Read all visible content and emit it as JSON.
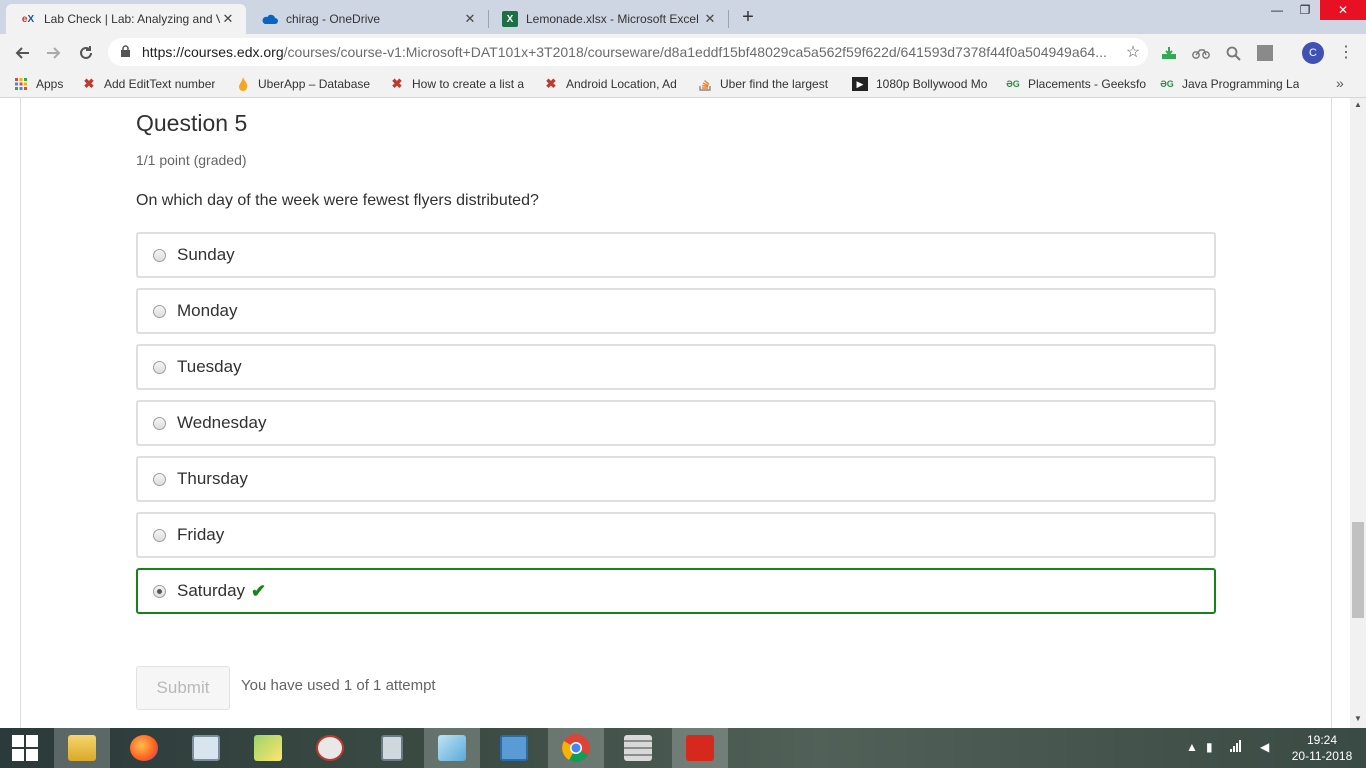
{
  "browser": {
    "tabs": [
      {
        "favicon": "edx-icon",
        "title": "Lab Check | Lab: Analyzing and V",
        "active": true
      },
      {
        "favicon": "onedrive-icon",
        "title": "chirag - OneDrive",
        "active": false
      },
      {
        "favicon": "excel-icon",
        "title": "Lemonade.xlsx - Microsoft Excel O",
        "active": false
      }
    ],
    "url_host": "https://courses.edx.org",
    "url_path": "/courses/course-v1:Microsoft+DAT101x+3T2018/courseware/d8a1eddf15bf48029ca5a562f59f622d/641593d7378f44f0a504949a64...",
    "profile_initial": "C",
    "bookmarks": [
      {
        "icon": "apps-grid-icon",
        "label": "Apps"
      },
      {
        "icon": "x-icon",
        "label": "Add EditText number"
      },
      {
        "icon": "flame-icon",
        "label": "UberApp – Database"
      },
      {
        "icon": "x-icon",
        "label": "How to create a list a"
      },
      {
        "icon": "x-icon",
        "label": "Android Location, Ad"
      },
      {
        "icon": "stackoverflow-icon",
        "label": "Uber find the largest"
      },
      {
        "icon": "play-icon",
        "label": "1080p Bollywood Mo"
      },
      {
        "icon": "gfg-icon",
        "label": "Placements - Geeksfo"
      },
      {
        "icon": "gfg-icon",
        "label": "Java Programming La"
      }
    ]
  },
  "question": {
    "title": "Question 5",
    "points": "1/1 point (graded)",
    "text": "On which day of the week were fewest flyers distributed?",
    "options": [
      {
        "label": "Sunday",
        "selected": false
      },
      {
        "label": "Monday",
        "selected": false
      },
      {
        "label": "Tuesday",
        "selected": false
      },
      {
        "label": "Wednesday",
        "selected": false
      },
      {
        "label": "Thursday",
        "selected": false
      },
      {
        "label": "Friday",
        "selected": false
      },
      {
        "label": "Saturday",
        "selected": true
      }
    ],
    "correct_symbol": "✔",
    "submit_label": "Submit",
    "attempts_text": "You have used 1 of 1 attempt"
  },
  "taskbar": {
    "time": "19:24",
    "date": "20-11-2018"
  },
  "colors": {
    "correct_green": "#178217",
    "option_border": "#dfdfdf",
    "tabstrip": "#cfd6e3"
  }
}
